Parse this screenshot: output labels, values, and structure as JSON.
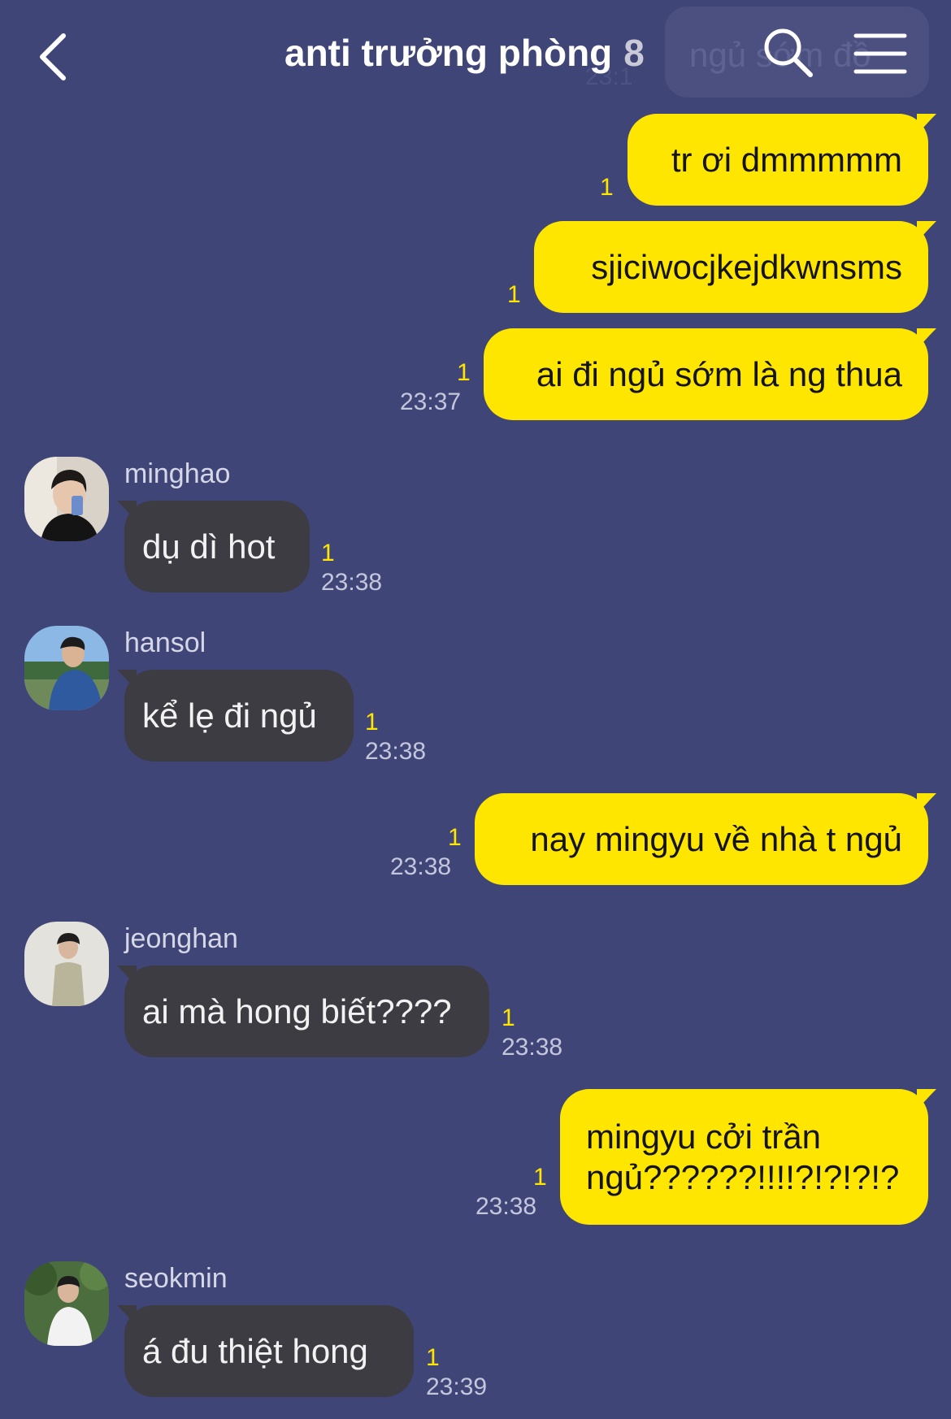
{
  "header": {
    "title": "anti trưởng phòng",
    "member_count": "8",
    "ghost_preview_text": "ngủ sớm đồ",
    "ghost_preview_time": "23:1"
  },
  "colors": {
    "background": "#404578",
    "my_bubble": "#ffe600",
    "other_bubble": "#3c3c42",
    "unread": "#ffe600"
  },
  "messages": [
    {
      "text": "tr ơi dmmmmm",
      "unread": "1"
    },
    {
      "text": "sjiciwocjkejdkwnsms",
      "unread": "1"
    },
    {
      "text": "ai đi ngủ sớm là ng thua",
      "unread": "1",
      "time": "23:37"
    },
    {
      "sender": "minghao",
      "text": "dụ dì hot",
      "unread": "1",
      "time": "23:38"
    },
    {
      "sender": "hansol",
      "text": "kể lẹ đi ngủ",
      "unread": "1",
      "time": "23:38"
    },
    {
      "text": "nay mingyu về nhà t ngủ",
      "unread": "1",
      "time": "23:38"
    },
    {
      "sender": "jeonghan",
      "text": "ai mà hong biết????",
      "unread": "1",
      "time": "23:38"
    },
    {
      "lines": [
        "mingyu cởi trần",
        "ngủ??????!!!!?!?!?!?"
      ],
      "unread": "1",
      "time": "23:38"
    },
    {
      "sender": "seokmin",
      "text": "á đu thiệt hong",
      "unread": "1",
      "time": "23:39"
    }
  ]
}
